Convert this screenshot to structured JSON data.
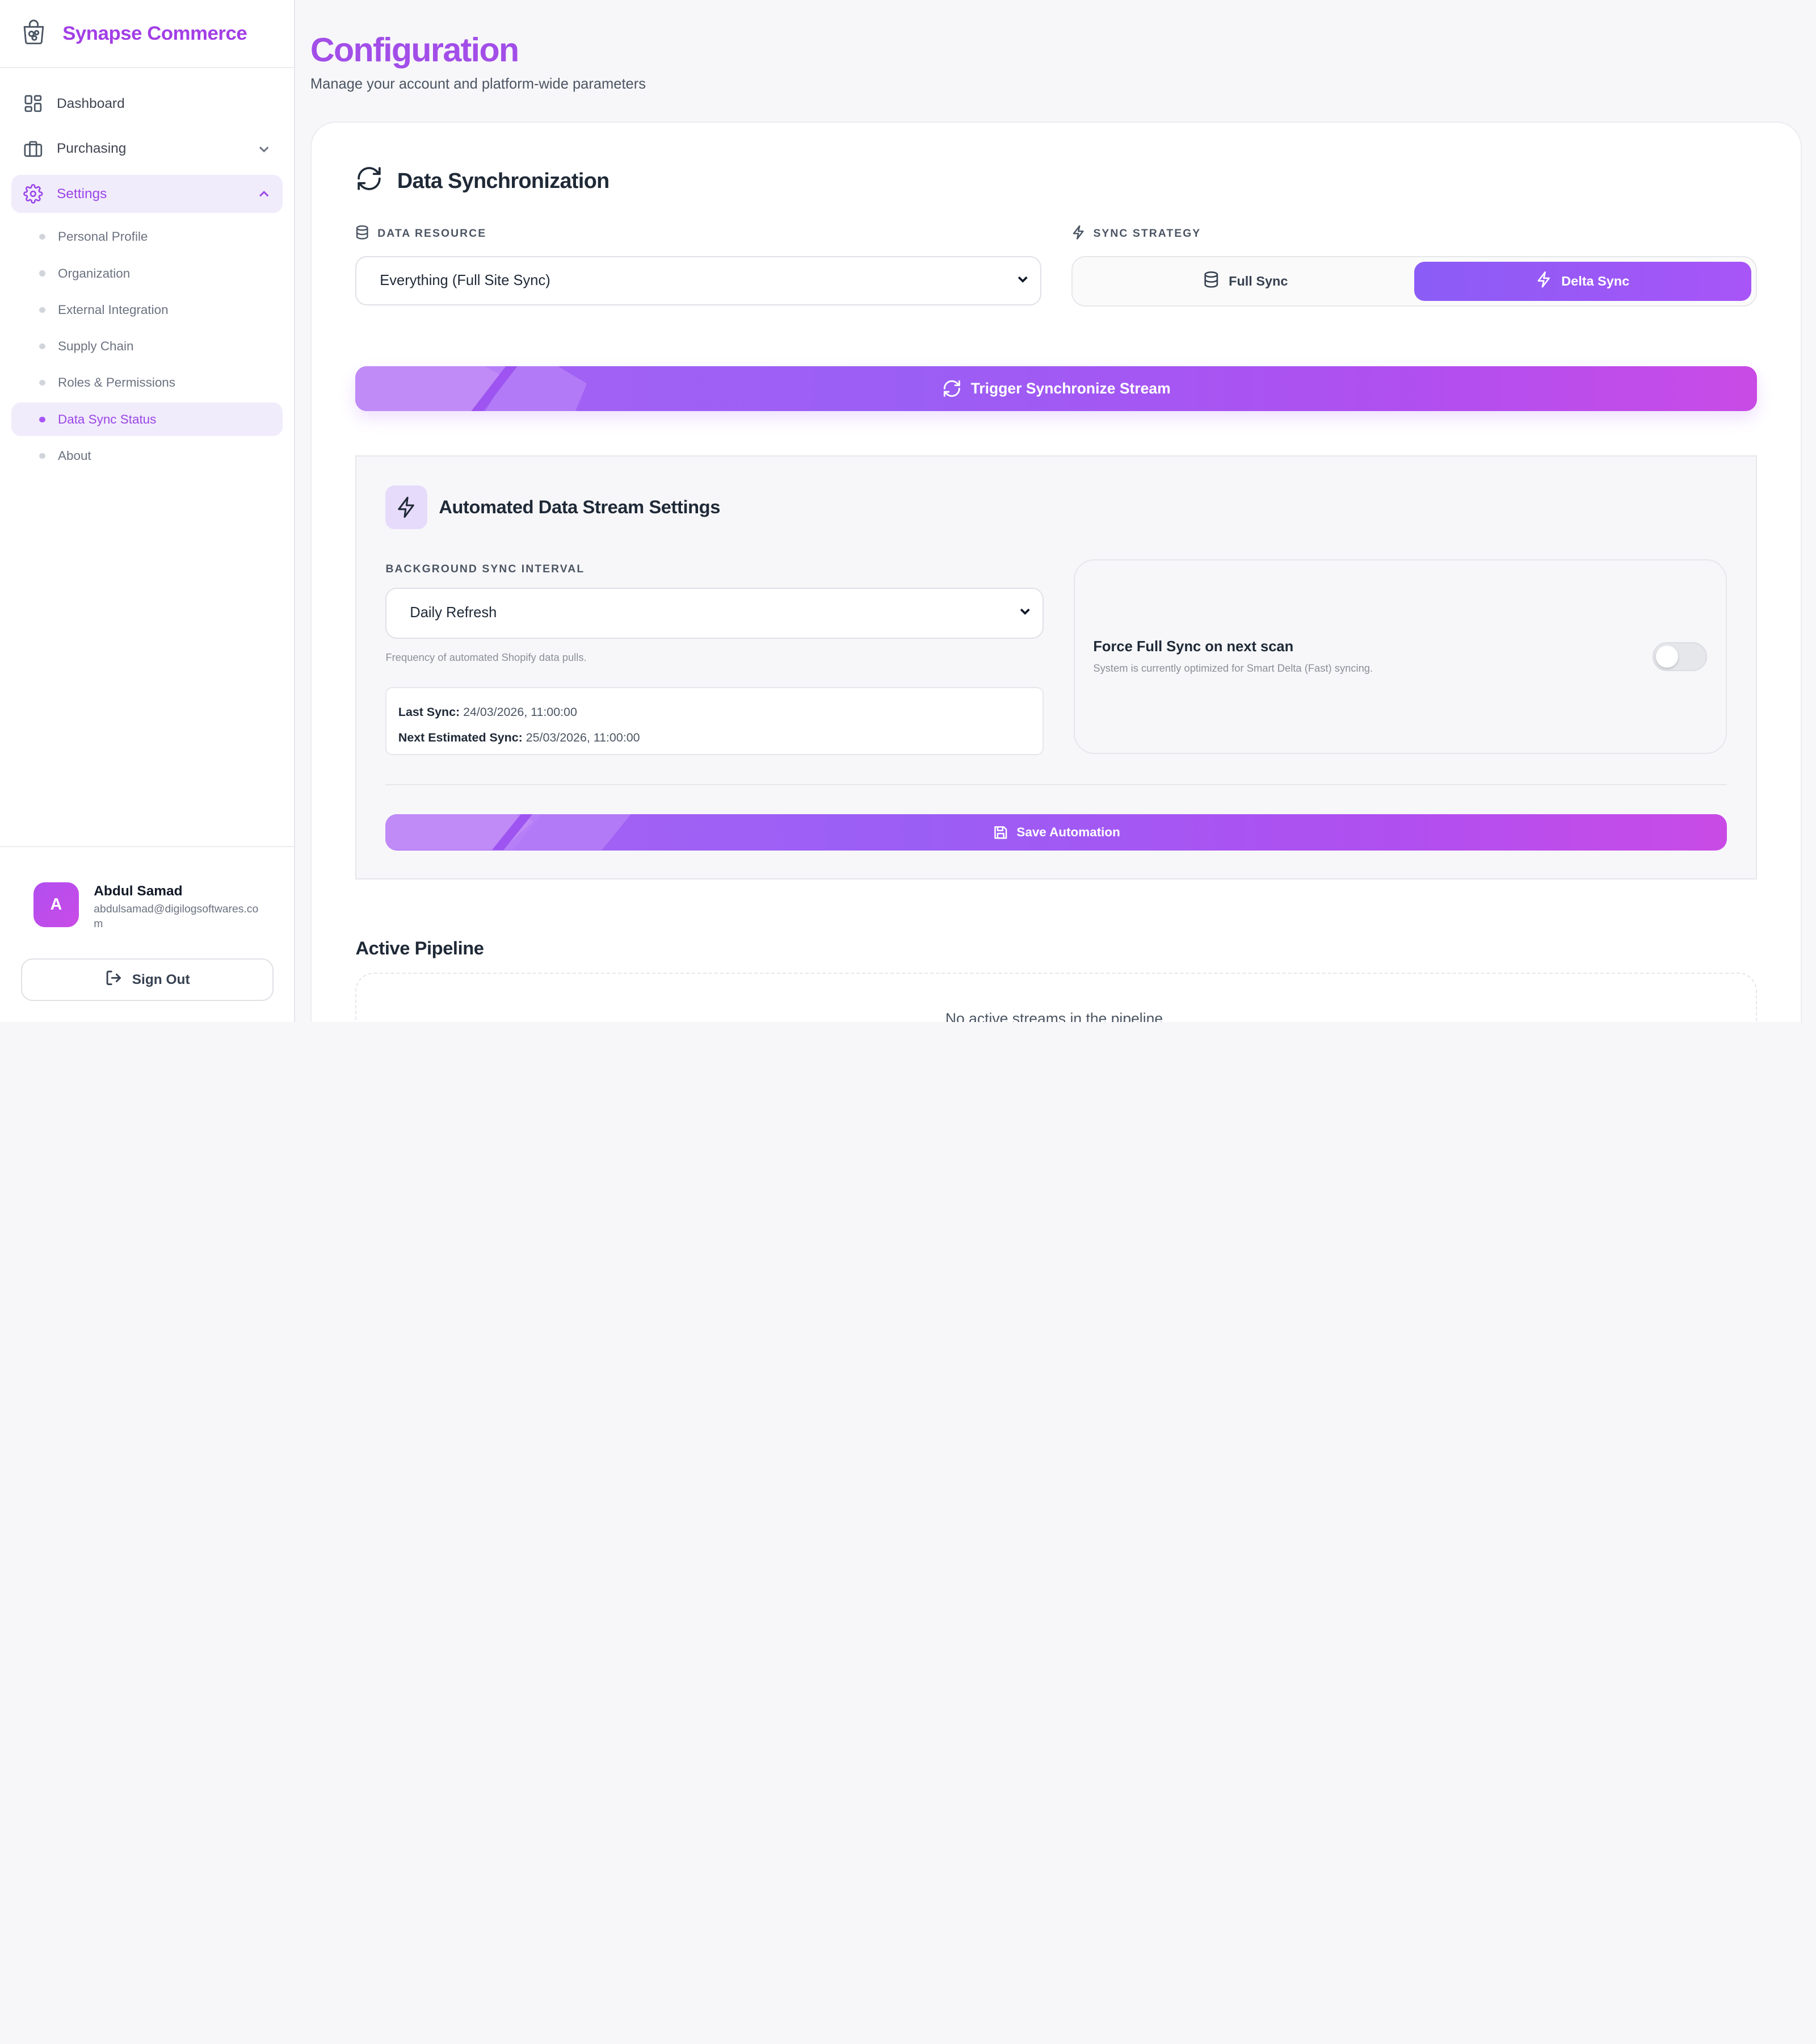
{
  "brand": {
    "name": "Synapse Commerce",
    "icon": "shopping-bag-brain-icon"
  },
  "nav": {
    "dashboard": "Dashboard",
    "purchasing": "Purchasing",
    "settings": "Settings",
    "sub_items": [
      "Personal Profile",
      "Organization",
      "External Integration",
      "Supply Chain",
      "Roles & Permissions",
      "Data Sync Status",
      "About"
    ],
    "active_sub": "Data Sync Status"
  },
  "user": {
    "initial": "A",
    "name": "Abdul Samad",
    "email": "abdulsamad@digilogsoftwares.com"
  },
  "signout_label": "Sign Out",
  "page": {
    "title": "Configuration",
    "subtitle": "Manage your account and platform-wide parameters"
  },
  "sync": {
    "title": "Data Synchronization",
    "resource_label": "Data Resource",
    "resource_value": "Everything (Full Site Sync)",
    "strategy_label": "Sync Strategy",
    "strategy_options": [
      "Full Sync",
      "Delta Sync"
    ],
    "strategy_selected": "Delta Sync",
    "trigger_label": "Trigger Synchronize Stream"
  },
  "automation": {
    "title": "Automated Data Stream Settings",
    "interval_label": "Background Sync Interval",
    "interval_value": "Daily Refresh",
    "interval_hint": "Frequency of automated Shopify data pulls.",
    "last_sync_label": "Last Sync:",
    "last_sync_value": "24/03/2026, 11:00:00",
    "next_sync_label": "Next Estimated Sync:",
    "next_sync_value": "25/03/2026, 11:00:00",
    "force_title": "Force Full Sync on next scan",
    "force_sub": "System is currently optimized for Smart Delta (Fast) syncing.",
    "force_enabled": false,
    "save_label": "Save Automation"
  },
  "pipeline": {
    "title": "Active Pipeline",
    "empty": "No active streams in the pipeline."
  },
  "colors": {
    "accent": "#a24ee8",
    "gradient_start": "#9b5ef5",
    "gradient_end": "#c94be6"
  }
}
